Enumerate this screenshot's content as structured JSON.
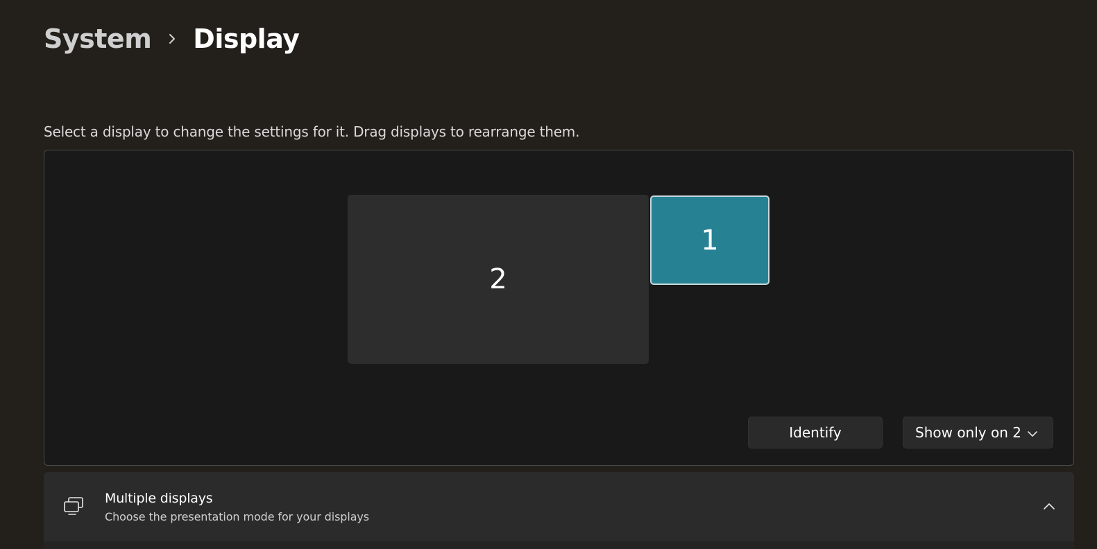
{
  "breadcrumb": {
    "parent": "System",
    "separator_icon": "chevron-right-icon",
    "current": "Display"
  },
  "arrange": {
    "instruction": "Select a display to change the settings for it. Drag displays to rearrange them.",
    "monitors": [
      {
        "label": "2",
        "selected": false,
        "color": "#2d2d2d"
      },
      {
        "label": "1",
        "selected": true,
        "color": "#268293"
      }
    ],
    "identify_label": "Identify",
    "dropdown": {
      "selected": "Show only on 2",
      "icon": "chevron-down-icon"
    }
  },
  "multiple_displays": {
    "icon": "multiple-displays-icon",
    "title": "Multiple displays",
    "subtitle": "Choose the presentation mode for your displays",
    "expanded": true,
    "toggle_icon": "chevron-up-icon"
  },
  "colors": {
    "background": "#23201c",
    "panel": "#191919",
    "accent": "#268293"
  }
}
